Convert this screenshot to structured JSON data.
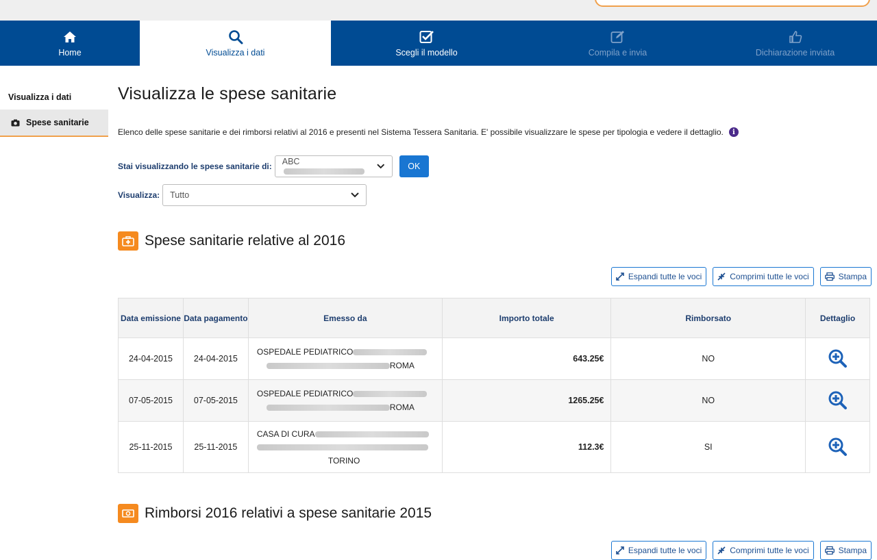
{
  "steps": [
    {
      "label": "Home",
      "icon": "home-icon",
      "state": "done"
    },
    {
      "label": "Visualizza i dati",
      "icon": "search-icon",
      "state": "active"
    },
    {
      "label": "Scegli il modello",
      "icon": "checkbox-icon",
      "state": "done"
    },
    {
      "label": "Compila e invia",
      "icon": "edit-icon",
      "state": "disabled"
    },
    {
      "label": "Dichiarazione inviata",
      "icon": "thumbs-up-icon",
      "state": "disabled"
    }
  ],
  "sidebar": {
    "title": "Visualizza i dati",
    "items": [
      {
        "label": "Spese sanitarie",
        "icon": "camera-icon"
      }
    ]
  },
  "main": {
    "title": "Visualizza le spese sanitarie",
    "intro": "Elenco delle spese sanitarie e dei rimborsi relativi al 2016 e presenti nel Sistema Tessera Sanitaria. E' possibile visualizzare le spese per tipologia e vedere il dettaglio.",
    "person_label": "Stai visualizzando le spese sanitarie di:",
    "person_value": "ABC",
    "ok_label": "OK",
    "view_label": "Visualizza:",
    "view_value": "Tutto"
  },
  "section1": {
    "title": "Spese sanitarie relative al 2016",
    "expand_label": "Espandi tutte le voci",
    "collapse_label": "Comprimi tutte le voci",
    "print_label": "Stampa",
    "columns": [
      "Data emissione",
      "Data pagamento",
      "Emesso da",
      "Importo totale",
      "Rimborsato",
      "Dettaglio"
    ],
    "rows": [
      {
        "emissione": "24-04-2015",
        "pagamento": "24-04-2015",
        "emesso_line1": "OSPEDALE PEDIATRICO",
        "emesso_city": "ROMA",
        "importo": "643.25€",
        "rimborsato": "NO"
      },
      {
        "emissione": "07-05-2015",
        "pagamento": "07-05-2015",
        "emesso_line1": "OSPEDALE PEDIATRICO",
        "emesso_city": "ROMA",
        "importo": "1265.25€",
        "rimborsato": "NO"
      },
      {
        "emissione": "25-11-2015",
        "pagamento": "25-11-2015",
        "emesso_line1": "CASA DI CURA",
        "emesso_city": "TORINO",
        "importo": "112.3€",
        "rimborsato": "SI"
      }
    ]
  },
  "section2": {
    "title": "Rimborsi 2016 relativi a spese sanitarie 2015",
    "expand_label": "Espandi tutte le voci",
    "collapse_label": "Comprimi tutte le voci",
    "print_label": "Stampa"
  },
  "colors": {
    "nav_blue": "#004b93",
    "accent_orange": "#f58a1f",
    "button_blue": "#1976d2"
  }
}
